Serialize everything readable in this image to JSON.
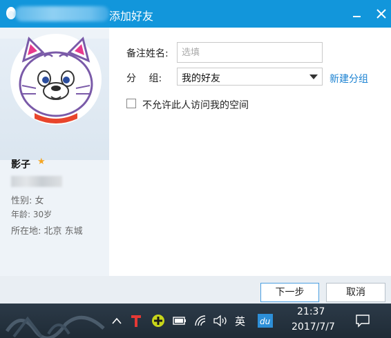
{
  "window": {
    "title": "添加好友"
  },
  "profile": {
    "name": "影子",
    "gender": "性别: 女",
    "age": "年龄: 30岁",
    "location": "所在地: 北京  东城"
  },
  "form": {
    "remark_label": "备注姓名:",
    "remark_placeholder": "选填",
    "group_label": "分　 组:",
    "group_value": "我的好友",
    "new_group_link": "新建分组",
    "deny_space_label": "不允许此人访问我的空间",
    "deny_space_checked": false
  },
  "buttons": {
    "next": "下一步",
    "cancel": "取消"
  },
  "taskbar": {
    "ime": "英",
    "time": "21:37",
    "date": "2017/7/7",
    "icons": [
      "chevron-up-icon",
      "t-app-icon",
      "plus-app-icon",
      "battery-icon",
      "wifi-icon",
      "volume-icon",
      "baidu-icon",
      "notification-icon"
    ]
  },
  "colors": {
    "accent": "#1296db",
    "link": "#1b82d2"
  }
}
